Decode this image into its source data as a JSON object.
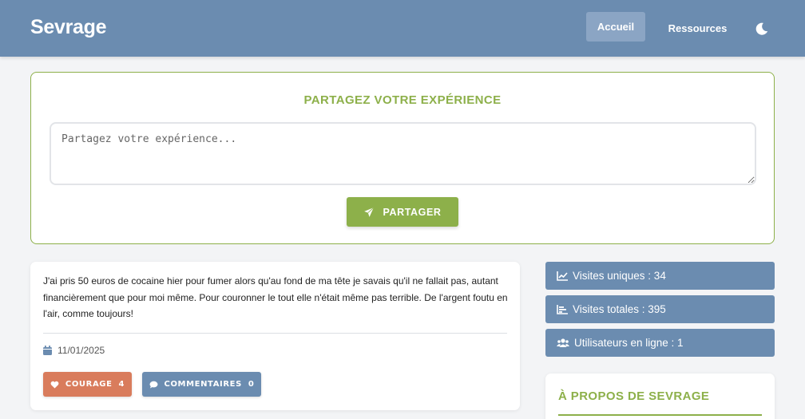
{
  "header": {
    "brand": "Sevrage",
    "nav": [
      {
        "label": "Accueil",
        "active": true
      },
      {
        "label": "Ressources",
        "active": false
      }
    ],
    "theme_icon": "moon-icon"
  },
  "share": {
    "title": "PARTAGEZ VOTRE EXPÉRIENCE",
    "placeholder": "Partagez votre expérience...",
    "value": "",
    "button_label": "PARTAGER",
    "button_icon": "paper-plane-icon"
  },
  "post": {
    "text": "J'ai pris 50 euros de cocaine hier pour fumer alors qu'au fond de ma tête je savais qu'il ne fallait pas, autant financièrement que pour moi même. Pour couronner le tout elle n'était même pas terrible. De l'argent foutu en l'air, comme toujours!",
    "date": "11/01/2025",
    "date_icon": "calendar-icon",
    "courage_label": "COURAGE",
    "courage_count": "4",
    "courage_icon": "heart-icon",
    "comments_label": "COMMENTAIRES",
    "comments_count": "0",
    "comments_icon": "comment-icon"
  },
  "stats": [
    {
      "icon": "chart-line-icon",
      "label": "Visites uniques : 34"
    },
    {
      "icon": "chart-bar-icon",
      "label": "Visites totales : 395"
    },
    {
      "icon": "users-icon",
      "label": "Utilisateurs en ligne : 1"
    }
  ],
  "about": {
    "title": "À PROPOS DE SEVRAGE"
  },
  "colors": {
    "header": "#6b8cb0",
    "accent_green": "#8db04a",
    "courage": "#d97c5c",
    "background": "#f3f4f6"
  }
}
